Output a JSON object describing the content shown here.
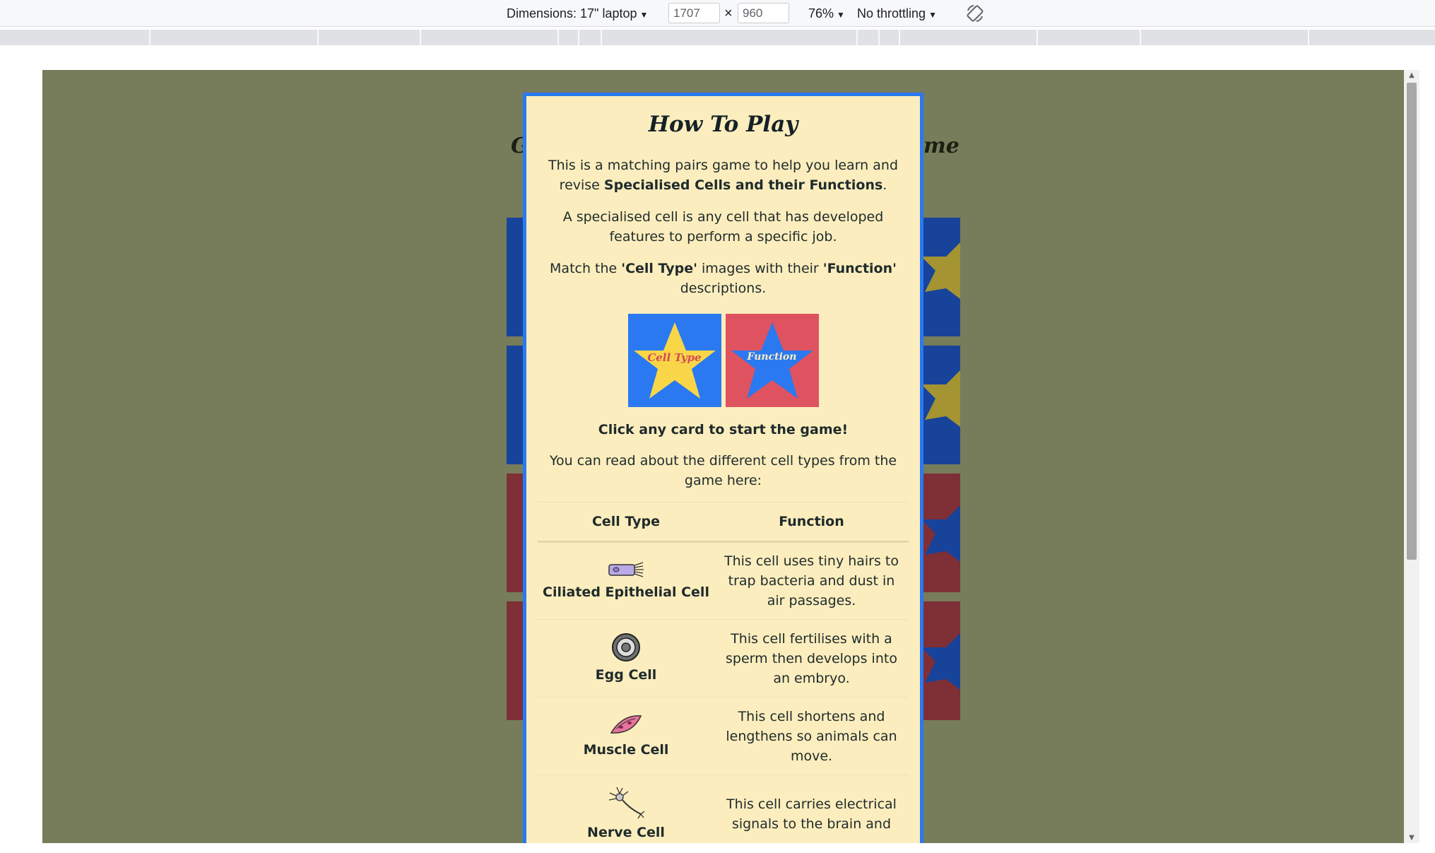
{
  "devtools": {
    "dimensions_label": "Dimensions: 17\" laptop",
    "width_value": "1707",
    "height_value": "960",
    "times": "×",
    "zoom": "76%",
    "throttling": "No throttling",
    "rotate_icon": "rotate-icon"
  },
  "modal": {
    "title": "How To Play",
    "intro_pre": "This is a matching pairs game to help you learn and revise ",
    "intro_bold": "Specialised Cells and their Functions",
    "intro_post": ".",
    "definition": "A specialised cell is any cell that has developed features to perform a specific job.",
    "match_pre": "Match the ",
    "match_bold1": "'Cell Type'",
    "match_mid": " images with their ",
    "match_bold2": "'Function'",
    "match_post": " descriptions.",
    "card_celltype_label": "Cell Type",
    "card_function_label": "Function",
    "start_prompt": "Click any card to start the game!",
    "read_about": "You can read about the different cell types from the game here:",
    "table": {
      "headers": [
        "Cell Type",
        "Function"
      ],
      "rows": [
        {
          "type": "Ciliated Epithelial Cell",
          "function": "This cell uses tiny hairs to trap bacteria and dust in air passages.",
          "icon": "ciliated-cell-icon"
        },
        {
          "type": "Egg Cell",
          "function": "This cell fertilises with a sperm then develops into an embryo.",
          "icon": "egg-cell-icon"
        },
        {
          "type": "Muscle Cell",
          "function": "This cell shortens and lengthens so animals can move.",
          "icon": "muscle-cell-icon"
        },
        {
          "type": "Nerve Cell",
          "function": "This cell carries electrical signals to the brain and",
          "icon": "nerve-cell-icon"
        }
      ]
    }
  },
  "colors": {
    "page_bg": "#777c5a",
    "modal_bg": "#fbedbd",
    "modal_border": "#2a79f1",
    "celltype_card": "#2a79f1",
    "function_card": "#df5360",
    "star_yellow": "#f8d648"
  }
}
